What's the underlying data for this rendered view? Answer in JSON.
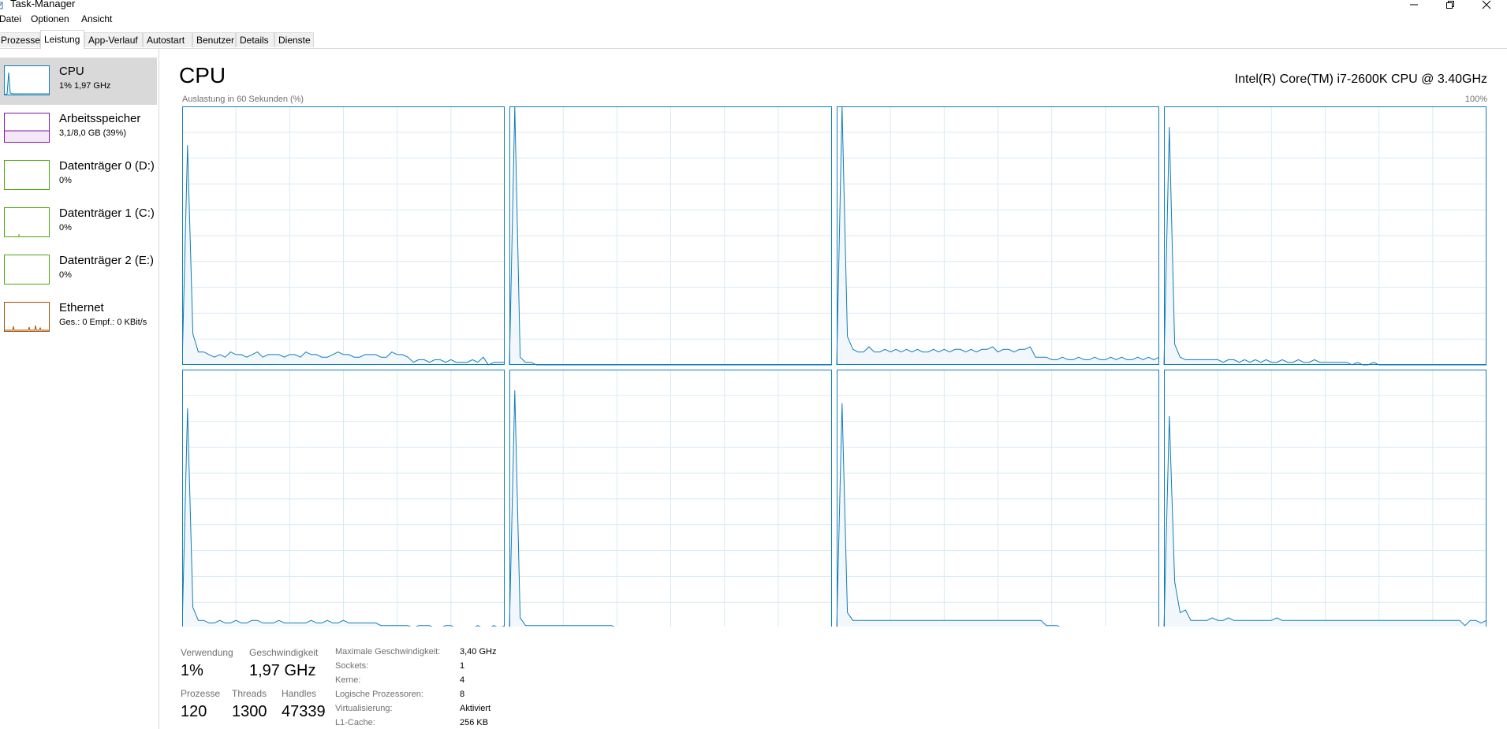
{
  "window": {
    "title": "Task-Manager"
  },
  "menu": {
    "items": [
      "Datei",
      "Optionen",
      "Ansicht"
    ]
  },
  "tabs": [
    "Prozesse",
    "Leistung",
    "App-Verlauf",
    "Autostart",
    "Benutzer",
    "Details",
    "Dienste"
  ],
  "active_tab": "Leistung",
  "sidebar": {
    "items": [
      {
        "name": "CPU",
        "sub": "1% 1,97 GHz",
        "color": "#117dbb",
        "selected": true
      },
      {
        "name": "Arbeitsspeicher",
        "sub": "3,1/8,0 GB (39%)",
        "color": "#8b12ae",
        "selected": false
      },
      {
        "name": "Datenträger 0 (D:)",
        "sub": "0%",
        "color": "#4da60c",
        "selected": false
      },
      {
        "name": "Datenträger 1 (C:)",
        "sub": "0%",
        "color": "#4da60c",
        "selected": false
      },
      {
        "name": "Datenträger 2 (E:)",
        "sub": "0%",
        "color": "#4da60c",
        "selected": false
      },
      {
        "name": "Ethernet",
        "sub": "Ges.: 0 Empf.: 0 KBit/s",
        "color": "#a74f01",
        "selected": false
      }
    ]
  },
  "main": {
    "title": "CPU",
    "cpu_model": "Intel(R) Core(TM) i7-2600K CPU @ 3.40GHz",
    "util_label": "Auslastung in 60 Sekunden (%)",
    "util_max": "100%",
    "graph_color": "#117dbb"
  },
  "stats": {
    "usage_label": "Verwendung",
    "usage_value": "1%",
    "speed_label": "Geschwindigkeit",
    "speed_value": "1,97 GHz",
    "processes_label": "Prozesse",
    "processes_value": "120",
    "threads_label": "Threads",
    "threads_value": "1300",
    "handles_label": "Handles",
    "handles_value": "47339"
  },
  "details": [
    {
      "label": "Maximale Geschwindigkeit:",
      "value": "3,40 GHz"
    },
    {
      "label": "Sockets:",
      "value": "1"
    },
    {
      "label": "Kerne:",
      "value": "4"
    },
    {
      "label": "Logische Prozessoren:",
      "value": "8"
    },
    {
      "label": "Virtualisierung:",
      "value": "Aktiviert"
    },
    {
      "label": "L1-Cache:",
      "value": "256 KB"
    }
  ],
  "chart_data": {
    "type": "area",
    "x_unit": "seconds",
    "xlim": [
      0,
      60
    ],
    "ylim": [
      0,
      100
    ],
    "series": [
      {
        "values": [
          0,
          85,
          12,
          5,
          5,
          4,
          3,
          4,
          3,
          5,
          4,
          4,
          3,
          4,
          5,
          3,
          4,
          4,
          4,
          3,
          4,
          4,
          3,
          5,
          4,
          4,
          3,
          3,
          4,
          5,
          4,
          4,
          3,
          3,
          4,
          4,
          4,
          3,
          3,
          5,
          4,
          4,
          3,
          1,
          2,
          2,
          1,
          2,
          2,
          1,
          2,
          1,
          1,
          1,
          2,
          1,
          3,
          0,
          1,
          1,
          1
        ]
      },
      {
        "values": [
          0,
          100,
          3,
          1,
          1,
          0,
          0,
          0,
          0,
          0,
          0,
          0,
          0,
          0,
          0,
          0,
          0,
          0,
          0,
          0,
          0,
          0,
          0,
          0,
          0,
          0,
          0,
          0,
          0,
          0,
          0,
          0,
          0,
          0,
          0,
          0,
          0,
          0,
          0,
          0,
          0,
          0,
          0,
          0,
          0,
          0,
          0,
          0,
          0,
          0,
          0,
          0,
          0,
          0,
          0,
          0,
          0,
          0,
          0,
          0,
          0
        ]
      },
      {
        "values": [
          0,
          100,
          11,
          6,
          5,
          5,
          7,
          5,
          5,
          6,
          5,
          6,
          5,
          6,
          5,
          6,
          5,
          5,
          6,
          5,
          6,
          5,
          6,
          6,
          5,
          6,
          5,
          6,
          6,
          7,
          5,
          6,
          6,
          5,
          6,
          6,
          7,
          3,
          3,
          3,
          2,
          2,
          3,
          2,
          2,
          3,
          2,
          2,
          3,
          2,
          2,
          3,
          2,
          3,
          2,
          2,
          3,
          2,
          3,
          2,
          3
        ]
      },
      {
        "values": [
          0,
          92,
          8,
          3,
          2,
          2,
          2,
          2,
          2,
          2,
          2,
          1,
          2,
          2,
          1,
          2,
          1,
          2,
          1,
          2,
          1,
          1,
          2,
          1,
          1,
          2,
          1,
          1,
          2,
          1,
          1,
          1,
          1,
          1,
          1,
          0,
          1,
          0,
          0,
          1,
          0,
          0,
          0,
          0,
          0,
          0,
          0,
          0,
          0,
          0,
          0,
          0,
          0,
          0,
          0,
          0,
          0,
          0,
          0,
          0,
          0
        ]
      },
      {
        "values": [
          0,
          85,
          8,
          3,
          3,
          2,
          2,
          3,
          2,
          2,
          3,
          2,
          2,
          3,
          3,
          2,
          2,
          2,
          3,
          2,
          2,
          2,
          2,
          2,
          3,
          2,
          2,
          3,
          2,
          2,
          3,
          2,
          2,
          2,
          2,
          2,
          2,
          1,
          1,
          1,
          1,
          1,
          1,
          0,
          1,
          1,
          1,
          0,
          0,
          1,
          1,
          0,
          0,
          0,
          0,
          1,
          0,
          0,
          1,
          0,
          1
        ]
      },
      {
        "values": [
          0,
          92,
          4,
          1,
          1,
          1,
          1,
          1,
          1,
          1,
          1,
          1,
          1,
          1,
          1,
          1,
          1,
          1,
          1,
          1,
          0,
          0,
          0,
          0,
          0,
          0,
          0,
          0,
          0,
          0,
          0,
          0,
          0,
          0,
          0,
          0,
          0,
          0,
          0,
          0,
          0,
          0,
          0,
          0,
          0,
          0,
          0,
          0,
          0,
          0,
          0,
          0,
          0,
          0,
          0,
          0,
          0,
          0,
          0,
          0,
          0
        ]
      },
      {
        "values": [
          0,
          87,
          6,
          3,
          3,
          3,
          3,
          3,
          3,
          3,
          3,
          3,
          3,
          3,
          3,
          3,
          3,
          3,
          3,
          3,
          3,
          3,
          3,
          3,
          3,
          3,
          3,
          3,
          3,
          3,
          3,
          3,
          3,
          3,
          3,
          3,
          3,
          3,
          3,
          1,
          1,
          1,
          0,
          0,
          0,
          0,
          0,
          0,
          0,
          0,
          0,
          0,
          0,
          0,
          0,
          0,
          0,
          0,
          0,
          0,
          0
        ]
      },
      {
        "values": [
          0,
          82,
          18,
          6,
          7,
          3,
          3,
          3,
          3,
          4,
          3,
          3,
          4,
          3,
          3,
          3,
          3,
          3,
          3,
          3,
          3,
          4,
          3,
          3,
          3,
          3,
          3,
          3,
          3,
          3,
          3,
          3,
          3,
          3,
          3,
          3,
          3,
          3,
          3,
          3,
          3,
          3,
          3,
          3,
          3,
          3,
          3,
          3,
          3,
          3,
          3,
          3,
          3,
          3,
          3,
          3,
          1,
          3,
          3,
          2,
          3
        ]
      }
    ]
  }
}
